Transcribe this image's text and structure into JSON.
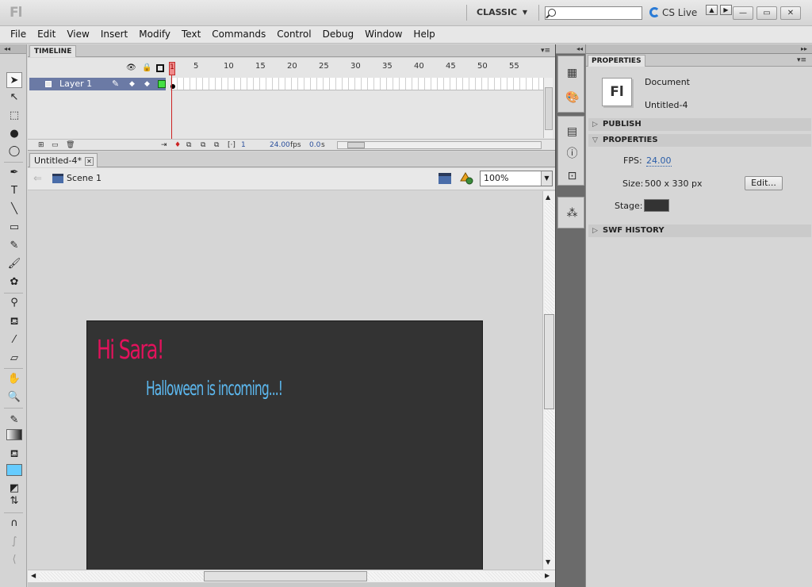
{
  "app": {
    "logo": "Fl",
    "workspace": "CLASSIC",
    "cs_live": "CS Live",
    "window_buttons": [
      "▲",
      "▶"
    ],
    "window_controls": [
      "—",
      "▭",
      "✕"
    ]
  },
  "menu": [
    "File",
    "Edit",
    "View",
    "Insert",
    "Modify",
    "Text",
    "Commands",
    "Control",
    "Debug",
    "Window",
    "Help"
  ],
  "timeline": {
    "tab": "TIMELINE",
    "frame_numbers": [
      "1",
      "5",
      "10",
      "15",
      "20",
      "25",
      "30",
      "35",
      "40",
      "45",
      "50",
      "55"
    ],
    "layer_name": "Layer 1",
    "current_frame": "1",
    "fps": "24.00",
    "fps_unit": "fps",
    "elapsed": "0.0",
    "elapsed_unit": "s"
  },
  "document": {
    "tab": "Untitled-4*",
    "scene": "Scene 1",
    "zoom": "100%",
    "stage_color": "#333333",
    "greeting_text": "Hi Sara!",
    "greeting_color": "#e3125c",
    "message_text": "Halloween is incoming...!",
    "message_color": "#5cb8ef"
  },
  "properties": {
    "tab": "PROPERTIES",
    "doc_type": "Document",
    "doc_name": "Untitled-4",
    "sections": {
      "publish": "PUBLISH",
      "properties": "PROPERTIES",
      "swf_history": "SWF HISTORY"
    },
    "fps_label": "FPS:",
    "fps_value": "24.00",
    "size_label": "Size:",
    "size_value": "500 x 330 px",
    "edit_button": "Edit...",
    "stage_label": "Stage:"
  }
}
